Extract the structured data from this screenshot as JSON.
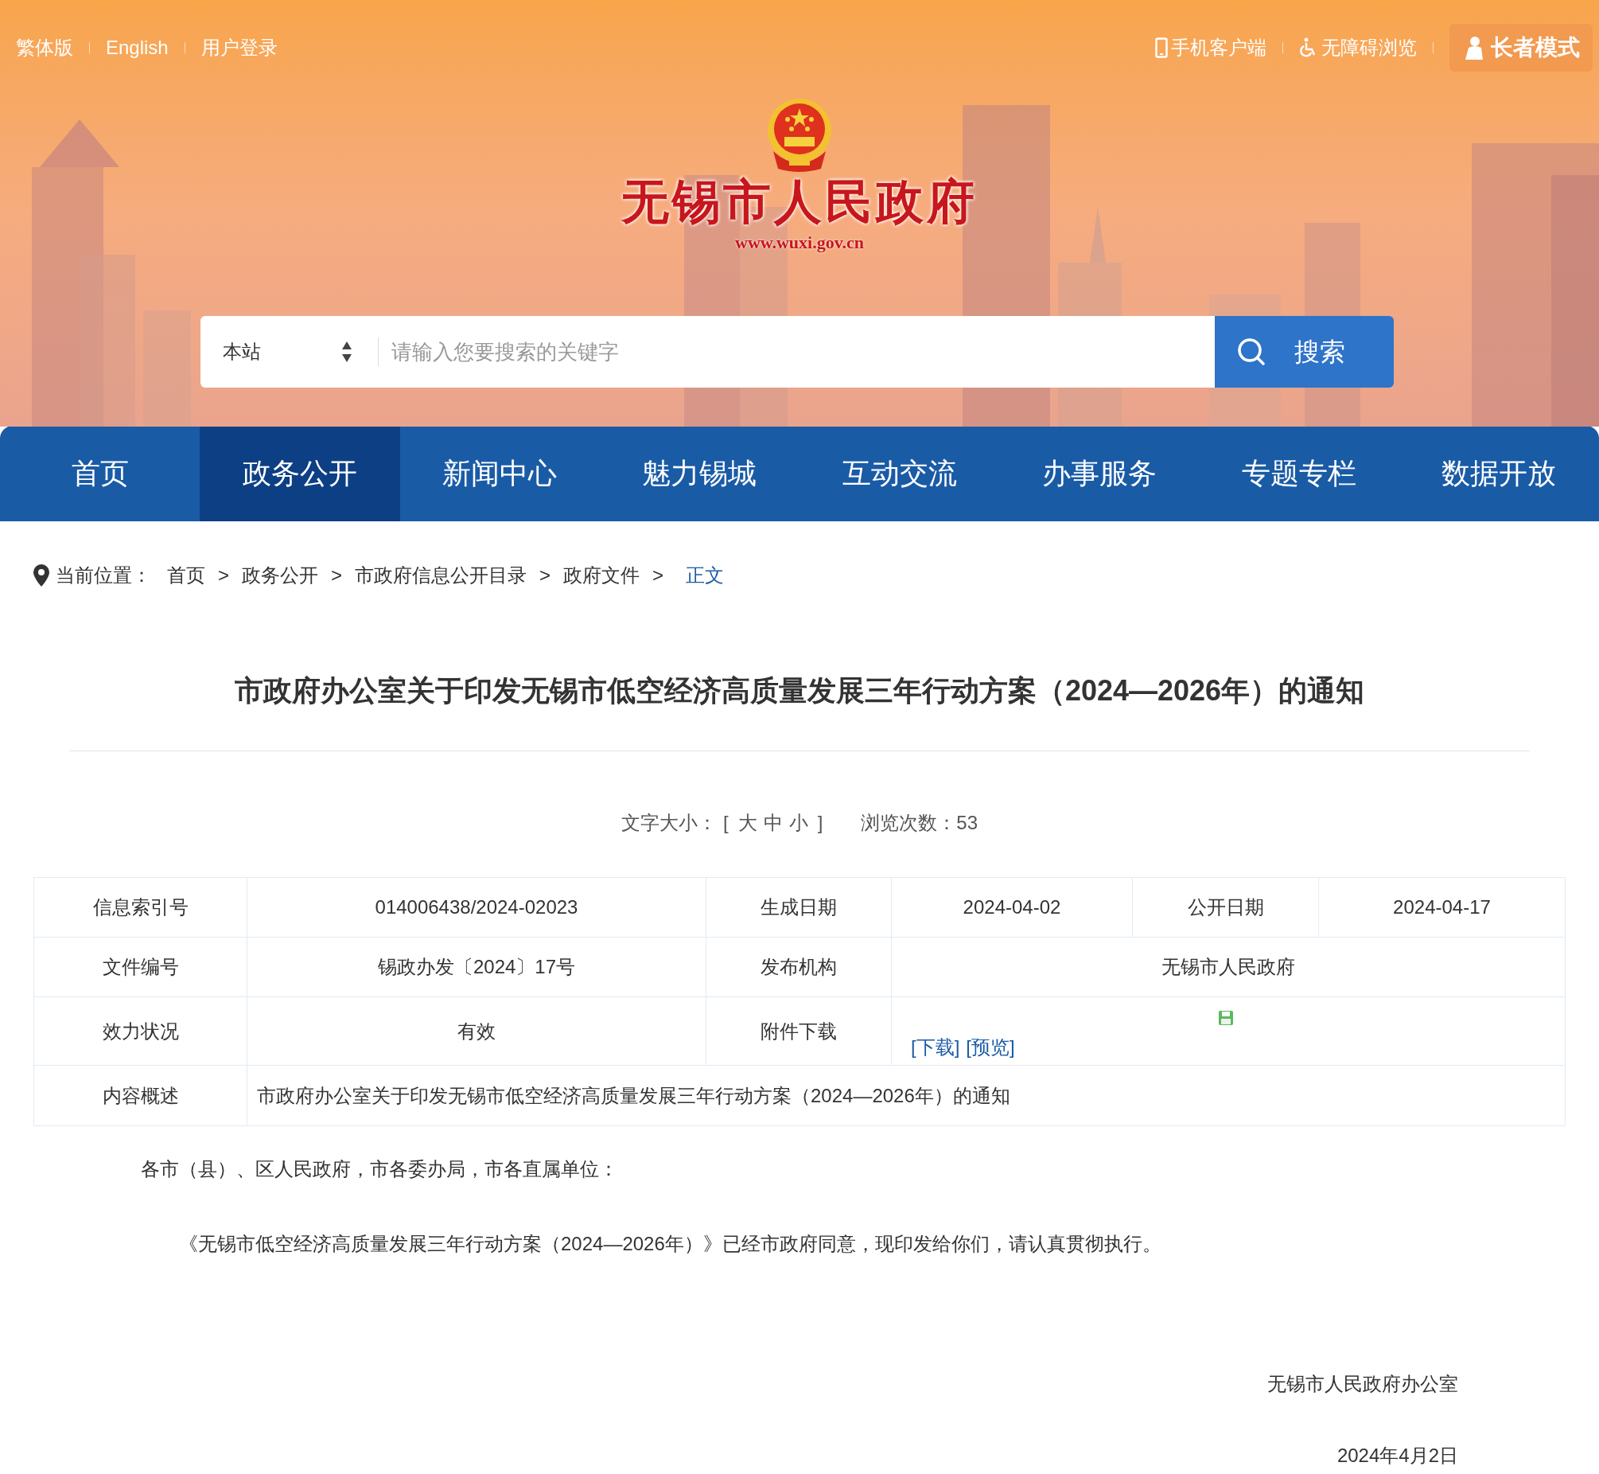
{
  "top_bar": {
    "left_links": [
      "繁体版",
      "English",
      "用户登录"
    ],
    "right_links": [
      {
        "label": "手机客户端",
        "kind": "mobile"
      },
      {
        "label": "无障碍浏览",
        "kind": "accessibility"
      }
    ],
    "elder_mode": "长者模式"
  },
  "header": {
    "site_name": "无锡市人民政府",
    "url": "www.wuxi.gov.cn"
  },
  "search": {
    "scope": "本站",
    "placeholder": "请输入您要搜索的关键字",
    "button": "搜索"
  },
  "nav": [
    {
      "label": "首页",
      "selected": false
    },
    {
      "label": "政务公开",
      "selected": true
    },
    {
      "label": "新闻中心",
      "selected": false
    },
    {
      "label": "魅力锡城",
      "selected": false
    },
    {
      "label": "互动交流",
      "selected": false
    },
    {
      "label": "办事服务",
      "selected": false
    },
    {
      "label": "专题专栏",
      "selected": false
    },
    {
      "label": "数据开放",
      "selected": false
    }
  ],
  "breadcrumb": {
    "label": "当前位置：",
    "items": [
      {
        "label": "首页",
        "current": false
      },
      {
        "label": "政务公开",
        "current": false
      },
      {
        "label": "市政府信息公开目录",
        "current": false
      },
      {
        "label": "政府文件",
        "current": false
      },
      {
        "label": "正文",
        "current": true
      }
    ],
    "separator": ">"
  },
  "article": {
    "title": "市政府办公室关于印发无锡市低空经济高质量发展三年行动方案（2024—2026年）的通知",
    "meta": {
      "font_size_label": "文字大小：",
      "bracket_open": "[",
      "sizes": [
        "大",
        "中",
        "小"
      ],
      "bracket_close": "]",
      "views": "浏览次数：53"
    },
    "info_table": {
      "rows": [
        {
          "cells": [
            {
              "kind": "label",
              "text": "信息索引号"
            },
            {
              "kind": "value",
              "text": "014006438/2024-02023"
            },
            {
              "kind": "label",
              "text": "生成日期"
            },
            {
              "kind": "value",
              "text": "2024-04-02"
            },
            {
              "kind": "label",
              "text": "公开日期"
            },
            {
              "kind": "value",
              "text": "2024-04-17"
            }
          ]
        },
        {
          "cells": [
            {
              "kind": "label",
              "text": "文件编号"
            },
            {
              "kind": "value",
              "text": "锡政办发〔2024〕17号"
            },
            {
              "kind": "label",
              "text": "发布机构"
            },
            {
              "kind": "value",
              "text": "无锡市人民政府",
              "colspan": 3
            }
          ]
        },
        {
          "cells": [
            {
              "kind": "label",
              "text": "效力状况"
            },
            {
              "kind": "value",
              "text": "有效"
            },
            {
              "kind": "label",
              "text": "附件下载"
            },
            {
              "kind": "attachment",
              "links": [
                "[下载]",
                "[预览]"
              ],
              "colspan": 3
            }
          ]
        },
        {
          "cells": [
            {
              "kind": "label",
              "text": "内容概述"
            },
            {
              "kind": "summary",
              "text": "市政府办公室关于印发无锡市低空经济高质量发展三年行动方案（2024—2026年）的通知",
              "colspan": 5
            }
          ]
        }
      ]
    },
    "paragraphs": [
      {
        "kind": "salutation",
        "text": "各市（县）、区人民政府，市各委办局，市各直属单位："
      },
      {
        "kind": "body",
        "text": "《无锡市低空经济高质量发展三年行动方案（2024—2026年）》已经市政府同意，现印发给你们，请认真贯彻执行。"
      }
    ],
    "signature": "无锡市人民政府办公室",
    "date": "2024年4月2日"
  }
}
